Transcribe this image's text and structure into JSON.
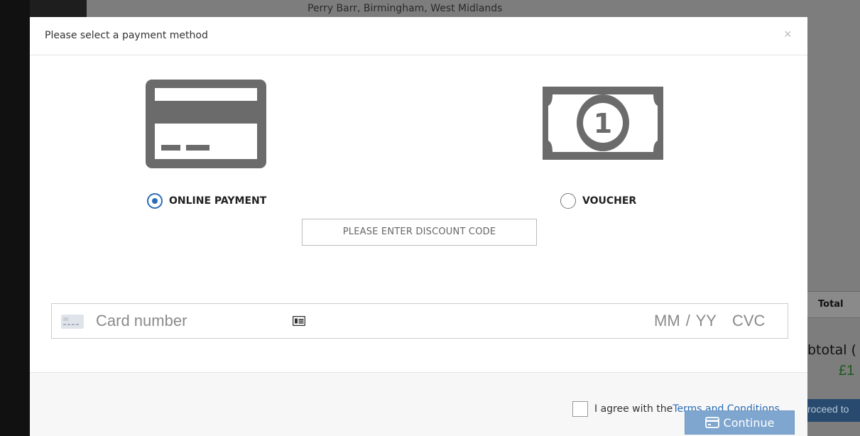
{
  "background": {
    "location_text": "Perry Barr, Birmingham, West Midlands",
    "table_header": "Total",
    "subtotal_label": "btotal (",
    "price": "£1",
    "proceed_label": "roceed to"
  },
  "modal": {
    "title": "Please select a payment method",
    "close": "×",
    "methods": [
      {
        "label": "ONLINE PAYMENT",
        "icon": "credit-card-icon",
        "selected": true
      },
      {
        "label": "VOUCHER",
        "icon": "banknote-icon",
        "selected": false
      }
    ],
    "discount_placeholder": "PLEASE ENTER DISCOUNT CODE",
    "card": {
      "number_placeholder": "Card number",
      "expiry_placeholder": "MM / YY",
      "cvc_placeholder": "CVC"
    },
    "footer": {
      "agree_text": "I agree with the ",
      "terms_link": "Terms and Conditions",
      "terms_end": ".",
      "continue_label": "Continue"
    }
  },
  "colors": {
    "accent": "#2a6db6",
    "icon_gray": "#6b6b6b",
    "continue_bg": "#7fa6cf"
  }
}
